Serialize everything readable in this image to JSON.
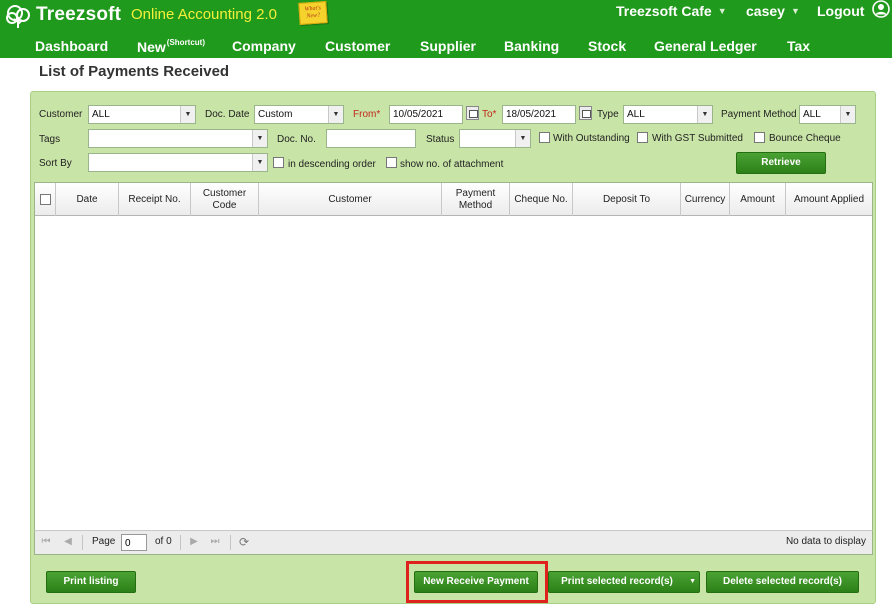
{
  "header": {
    "logo_text": "Treezsoft",
    "app_subtitle": "Online Accounting 2.0",
    "whats_new": "What's New?",
    "company": "Treezsoft Cafe",
    "user": "casey",
    "logout": "Logout"
  },
  "nav": {
    "dashboard": "Dashboard",
    "new": "New",
    "new_sup": "(Shortcut)",
    "company": "Company",
    "customer": "Customer",
    "supplier": "Supplier",
    "banking": "Banking",
    "stock": "Stock",
    "general_ledger": "General Ledger",
    "tax": "Tax"
  },
  "page": {
    "title": "List of Payments Received"
  },
  "filters": {
    "customer_label": "Customer",
    "customer_value": "ALL",
    "doc_date_label": "Doc. Date",
    "doc_date_value": "Custom",
    "from_label": "From*",
    "from_value": "10/05/2021",
    "to_label": "To*",
    "to_value": "18/05/2021",
    "type_label": "Type",
    "type_value": "ALL",
    "payment_method_label": "Payment Method",
    "payment_method_value": "ALL",
    "tags_label": "Tags",
    "tags_value": "",
    "doc_no_label": "Doc. No.",
    "doc_no_value": "",
    "status_label": "Status",
    "status_value": "",
    "with_outstanding_label": "With Outstanding",
    "with_gst_label": "With GST Submitted",
    "bounce_cheque_label": "Bounce Cheque",
    "sort_by_label": "Sort By",
    "sort_by_value": "",
    "descending_label": "in descending order",
    "attachment_label": "show no. of attachment",
    "retrieve_button": "Retrieve"
  },
  "grid": {
    "columns": {
      "date": "Date",
      "receipt_no": "Receipt No.",
      "customer_code_1": "Customer",
      "customer_code_2": "Code",
      "customer": "Customer",
      "payment_method_1": "Payment",
      "payment_method_2": "Method",
      "cheque_no": "Cheque No.",
      "deposit_to": "Deposit To",
      "currency": "Currency",
      "amount": "Amount",
      "amount_applied": "Amount Applied"
    },
    "rows": []
  },
  "pager": {
    "page_label": "Page",
    "page_value": "0",
    "of_label": "of 0",
    "no_data": "No data to display"
  },
  "footer": {
    "print_listing": "Print listing",
    "new_receive_payment": "New Receive Payment",
    "print_selected": "Print selected record(s)",
    "delete_selected": "Delete selected record(s)"
  },
  "colors": {
    "header_green": "#209a1c",
    "panel_green": "#c9e4a7",
    "button_green": "#2c8018",
    "subtitle_yellow": "#f4ef3a",
    "required_red": "#c0281b",
    "highlight_red": "#e0221c"
  }
}
